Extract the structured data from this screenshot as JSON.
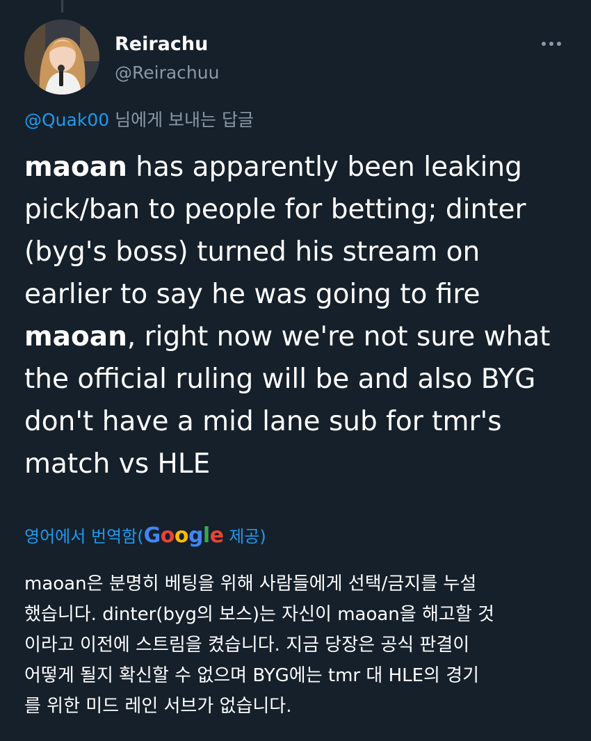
{
  "user": {
    "display_name": "Reirachu",
    "handle": "@Reirachuu"
  },
  "reply": {
    "mention": "@Quak00",
    "suffix": " 님에게 보내는 답글"
  },
  "tweet": {
    "segments": [
      {
        "text": "maoan",
        "bold": true
      },
      {
        "text": " has apparently been leaking\npick/ban to people for betting; dinter\n(byg's boss) turned his stream on\nearlier to say he was going to fire\n",
        "bold": false
      },
      {
        "text": "maoan",
        "bold": true
      },
      {
        "text": ", right now we're not sure what\nthe official ruling will be and also BYG\ndon't have a mid lane sub for tmr's\nmatch vs HLE",
        "bold": false
      }
    ]
  },
  "translation": {
    "prefix": "영어에서 번역함(",
    "provider": "Google",
    "suffix": " 제공)",
    "text": "maoan은 분명히 베팅을 위해 사람들에게 선택/금지를 누설\n했습니다. dinter(byg의 보스)는 자신이 maoan을 해고할 것\n이라고 이전에 스트림을 켰습니다. 지금 당장은 공식 판결이\n어떻게 될지 확신할 수 없으며 BYG에는 tmr 대 HLE의 경기\n를 위한 미드 레인 서브가 없습니다."
  },
  "colors": {
    "background": "#15202b",
    "accent": "#1d9bf0",
    "secondary_text": "#8b98a5"
  },
  "icons": {
    "more": "more-horizontal-icon"
  }
}
